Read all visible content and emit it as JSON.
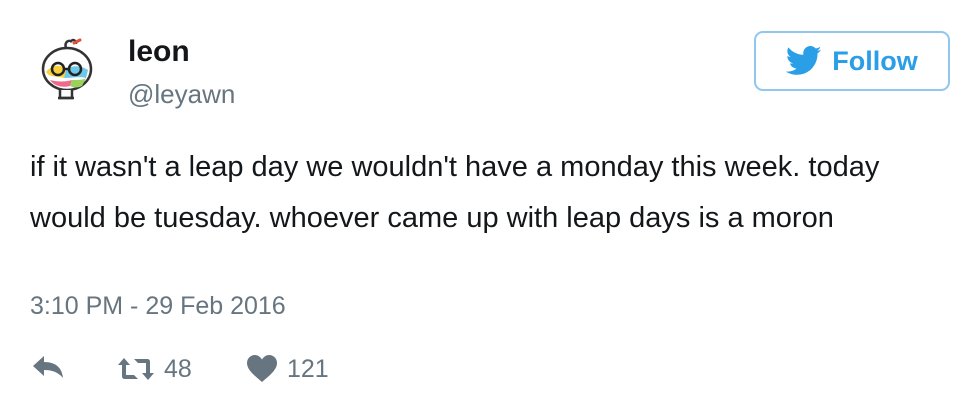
{
  "user": {
    "display_name": "leon",
    "handle": "@leyawn"
  },
  "follow_button": {
    "label": "Follow"
  },
  "tweet": {
    "text": "if it wasn't a leap day we wouldn't have a monday this week. today would be tuesday. whoever came up with leap days is a moron",
    "timestamp": "3:10 PM - 29 Feb 2016"
  },
  "actions": {
    "reply_icon": "reply-icon",
    "retweet_icon": "retweet-icon",
    "retweet_count": "48",
    "like_icon": "heart-icon",
    "like_count": "121"
  },
  "colors": {
    "accent": "#2a9ee6",
    "secondary_text": "#66757f",
    "primary_text": "#14171a",
    "button_border": "#90c7ee"
  }
}
